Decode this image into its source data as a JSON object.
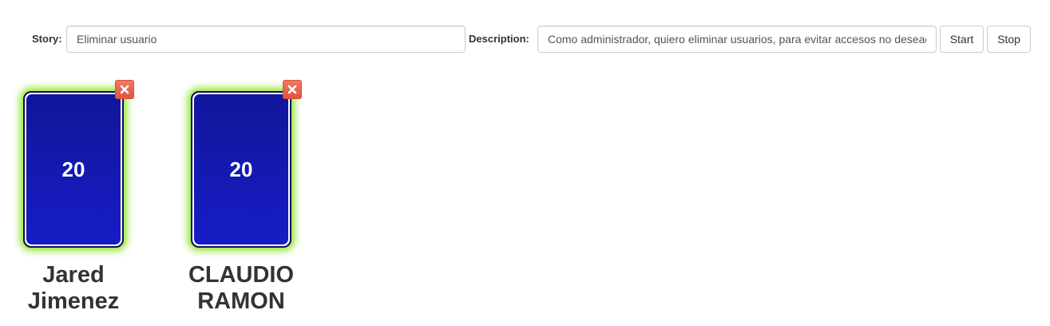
{
  "toolbar": {
    "story_label": "Story:",
    "story_value": "Eliminar usuario",
    "description_label": "Description:",
    "description_value": "Como administrador, quiero eliminar usuarios, para evitar accesos no deseados",
    "start_label": "Start",
    "stop_label": "Stop"
  },
  "players": [
    {
      "name": "Jared Jimenez",
      "card_value": "20",
      "remove_icon": "close-icon"
    },
    {
      "name": "CLAUDIO RAMON",
      "card_value": "20",
      "remove_icon": "close-icon"
    }
  ],
  "colors": {
    "card_blue": "#171cc6",
    "card_glow": "#a8e85a",
    "remove_red": "#e8644b"
  }
}
